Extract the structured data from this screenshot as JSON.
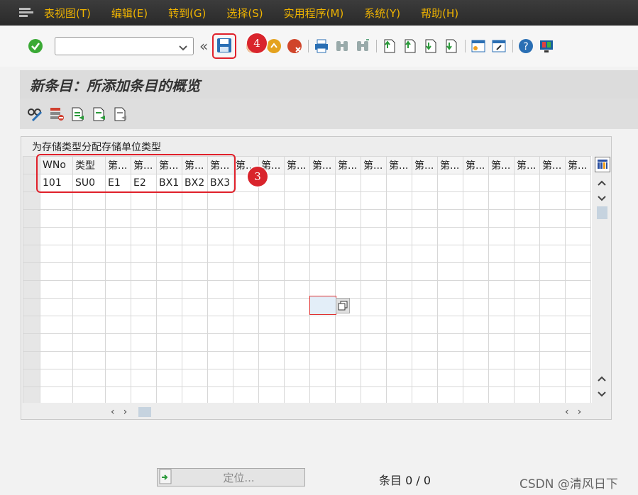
{
  "menu": {
    "items": [
      "表视图(T)",
      "编辑(E)",
      "转到(G)",
      "选择(S)",
      "实用程序(M)",
      "系统(Y)",
      "帮助(H)"
    ]
  },
  "toolbar": {
    "command_value": "",
    "collapse_glyph": "«",
    "badge_save": "4"
  },
  "title": "新条目：所添加条目的概览",
  "panel": {
    "title": "为存储类型分配存储单位类型",
    "columns": [
      "WNo",
      "类型",
      "第...",
      "第...",
      "第...",
      "第...",
      "第...",
      "第...",
      "第...",
      "第...",
      "第...",
      "第...",
      "第...",
      "第...",
      "第...",
      "第...",
      "第...",
      "第...",
      "第...",
      "第...",
      "第..."
    ],
    "rows": [
      [
        "101",
        "SU0",
        "E1",
        "E2",
        "BX1",
        "BX2",
        "BX3",
        "",
        "",
        "",
        "",
        "",
        "",
        "",
        "",
        "",
        "",
        "",
        "",
        "",
        ""
      ]
    ],
    "empty_rows": 12,
    "badge_rows": "3"
  },
  "footer": {
    "position_label": "定位...",
    "entries": "条目 0 / 0",
    "watermark": "CSDN @清风日下"
  },
  "colors": {
    "menubar_text": "#f0b400",
    "highlight_red": "#e0202a",
    "badge_red": "#d9242c"
  }
}
